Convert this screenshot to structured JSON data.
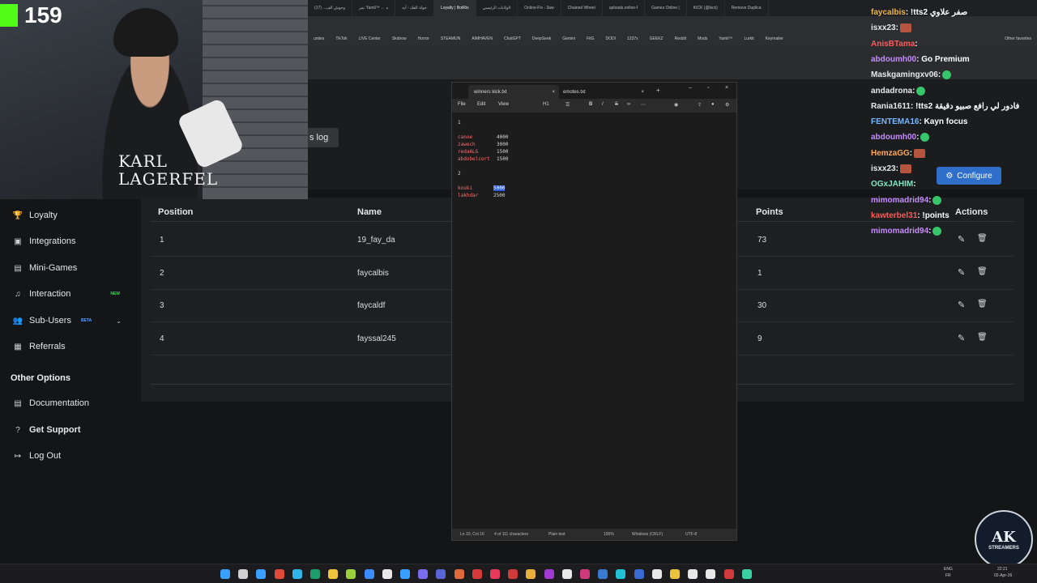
{
  "browser": {
    "tabs": [
      "وحوش الف... (17)",
      "نمر Yamil™ ← ه",
      "جولة الفك - آيه",
      "Loyalty | BotRix",
      "الولايات الرئيسي",
      "Online-Fix - 3aw",
      "Chained Wheel",
      "uploads.online-f",
      "Games Online |",
      "KICK (@kick)",
      "Remove Duplica"
    ],
    "active_tab": "Loyalty | BotRix",
    "bookmarks": [
      "unties",
      "TikTok",
      "LIVE Center",
      "Skidrow",
      "Horror",
      "STEAMUN",
      "AIMHAVEN",
      "ChatGPT",
      "DeepSeek",
      "Gemini",
      "FitG",
      "DODI",
      "1337x",
      "GEEKZ",
      "Reddit",
      "Mods",
      "Yamil™",
      "Lurkit",
      "Keymailer"
    ],
    "bookmarks_right": "Other favorites"
  },
  "page": {
    "log_chip": "s log"
  },
  "sidebar": {
    "items": [
      {
        "label": "Loyalty",
        "icon": "trophy-icon"
      },
      {
        "label": "Integrations",
        "icon": "integrations-icon"
      },
      {
        "label": "Mini-Games",
        "icon": "gamepad-icon"
      },
      {
        "label": "Interaction",
        "icon": "music-icon",
        "badge": "NEW"
      },
      {
        "label": "Sub-Users",
        "icon": "users-icon",
        "badge": "BETA"
      },
      {
        "label": "Referrals",
        "icon": "referrals-icon"
      }
    ],
    "other_title": "Other Options",
    "other_items": [
      {
        "label": "Documentation",
        "icon": "document-icon"
      },
      {
        "label": "Get Support",
        "icon": "help-icon"
      },
      {
        "label": "Log Out",
        "icon": "logout-icon"
      }
    ]
  },
  "table": {
    "headers": {
      "position": "Position",
      "name": "Name",
      "points": "Points",
      "actions": "Actions"
    },
    "rows": [
      {
        "position": "1",
        "name": "19_fay_da",
        "points": "73"
      },
      {
        "position": "2",
        "name": "faycalbis",
        "points": "1"
      },
      {
        "position": "3",
        "name": "faycaldf",
        "points": "30"
      },
      {
        "position": "4",
        "name": "fayssal245",
        "points": "9"
      }
    ]
  },
  "notepad": {
    "tabs": [
      "winners kick.txt",
      "emotes.txt"
    ],
    "menu": [
      "File",
      "Edit",
      "View"
    ],
    "heading_tool": "H1",
    "lines": [
      {
        "name": "1"
      },
      {
        "name": "canoe",
        "value": "4000"
      },
      {
        "name": "zawech",
        "value": "3000"
      },
      {
        "name": "redaALG",
        "value": "1500"
      },
      {
        "name": "abdobelcort",
        "value": "1500"
      },
      {
        "name": "2"
      },
      {
        "name": "kouki",
        "value": "5000"
      },
      {
        "name": "lakhdar",
        "value": "2500"
      }
    ],
    "status": {
      "cursor": "Ln 10, Col 16",
      "chars": "4 of 111 characters",
      "format": "Plain text",
      "zoom": "100%",
      "line_ending": "Windows (CRLF)",
      "encoding": "UTF-8"
    }
  },
  "webcam": {
    "viewer_count": "159",
    "shirt_line1": "KARL",
    "shirt_line2": "LAGERFEL"
  },
  "chat": {
    "messages": [
      {
        "user": "faycalbis",
        "text": ": !tts2 صفر علاوي",
        "color": "#e8b64f"
      },
      {
        "user": "isxx23",
        "text": ":",
        "color": "#e8e8e8",
        "emote": "r"
      },
      {
        "user": "AnisBTama",
        "text": ":",
        "color": "#ff5a5a"
      },
      {
        "user": "abdoumh00",
        "text": ": Go Premium",
        "color": "#c58bff"
      },
      {
        "user": "Maskgamingxv06",
        "text": ":",
        "color": "#e8e8e8",
        "emote": "g"
      },
      {
        "user": "andadrona",
        "text": ":",
        "color": "#e8e8e8",
        "emote": "g"
      },
      {
        "user": "Rania1611",
        "text": ": !tts2 فادور لي رافع صبيو دقيقة",
        "color": "#e8e8e8"
      },
      {
        "user": "FENTEMA16",
        "text": ": Kayn focus",
        "color": "#7ab7ff"
      },
      {
        "user": "abdoumh00",
        "text": ":",
        "color": "#c58bff",
        "emote": "g"
      },
      {
        "user": "HemzaGG",
        "text": ":",
        "color": "#ffa85a",
        "emote": "r"
      },
      {
        "user": "isxx23",
        "text": ":",
        "color": "#e8e8e8",
        "emote": "r"
      },
      {
        "user": "OGxJAHIM",
        "text": ":",
        "color": "#7fe8c0"
      },
      {
        "user": "mimomadrid94",
        "text": ":",
        "color": "#c58bff",
        "emote": "g"
      },
      {
        "user": "kawterbel31",
        "text": ": !points",
        "color": "#ff5a5a"
      },
      {
        "user": "mimomadrid94",
        "text": ":",
        "color": "#c58bff",
        "emote": "g"
      }
    ],
    "configure_label": "Configure"
  },
  "logo": {
    "line1": "AK",
    "line2": "STREAMERS"
  },
  "taskbar": {
    "lang": "ENG",
    "lang2": "FR",
    "time": "22:21",
    "date": "02-Apr-26"
  }
}
